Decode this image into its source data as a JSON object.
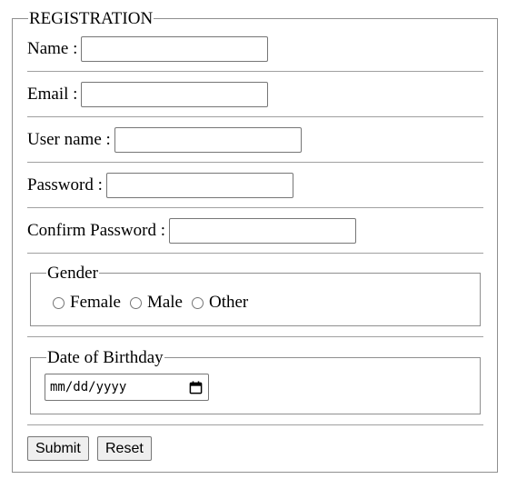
{
  "form": {
    "legend": "REGISTRATION",
    "fields": [
      {
        "label": "Name :",
        "value": ""
      },
      {
        "label": "Email :",
        "value": ""
      },
      {
        "label": "User name :",
        "value": ""
      },
      {
        "label": "Password :",
        "value": ""
      },
      {
        "label": "Confirm Password :",
        "value": ""
      }
    ],
    "gender": {
      "legend": "Gender",
      "options": [
        "Female",
        "Male",
        "Other"
      ]
    },
    "birthday": {
      "legend": "Date of Birthday",
      "placeholder": "mm/dd/yyyy"
    },
    "buttons": {
      "submit": "Submit",
      "reset": "Reset"
    }
  }
}
